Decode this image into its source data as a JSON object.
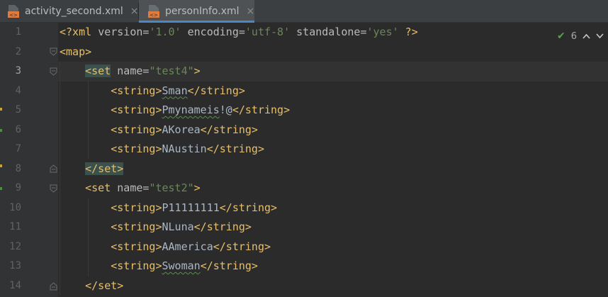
{
  "tabs": [
    {
      "label": "activity_second.xml",
      "active": false,
      "icon": "xml-file-icon",
      "close": "×"
    },
    {
      "label": "personInfo.xml",
      "active": true,
      "icon": "xml-file-icon",
      "close": "×"
    }
  ],
  "inspection": {
    "icon": "check-icon",
    "count": "6",
    "up": "^",
    "down": "v"
  },
  "lines": [
    {
      "number": "1",
      "segments": [
        {
          "t": "<?xml ",
          "c": "tg"
        },
        {
          "t": "version=",
          "c": "an"
        },
        {
          "t": "'1.0'",
          "c": "av"
        },
        {
          "t": " encoding=",
          "c": "an"
        },
        {
          "t": "'utf-8'",
          "c": "av"
        },
        {
          "t": " standalone=",
          "c": "an"
        },
        {
          "t": "'yes'",
          "c": "av"
        },
        {
          "t": " ?>",
          "c": "tg"
        }
      ]
    },
    {
      "number": "2",
      "segments": [
        {
          "t": "<map>",
          "c": "tg"
        }
      ]
    },
    {
      "number": "3",
      "segments": [
        {
          "t": "    ",
          "c": "tx"
        },
        {
          "t": "<set",
          "c": "tg",
          "hl": true
        },
        {
          "t": " name=",
          "c": "an"
        },
        {
          "t": "\"test4\"",
          "c": "av"
        },
        {
          "t": ">",
          "c": "tg"
        }
      ]
    },
    {
      "number": "4",
      "segments": [
        {
          "t": "        ",
          "c": "tx"
        },
        {
          "t": "<string>",
          "c": "tg"
        },
        {
          "t": "Sman",
          "c": "tx",
          "wavy": true
        },
        {
          "t": "</string>",
          "c": "tg"
        }
      ]
    },
    {
      "number": "5",
      "segments": [
        {
          "t": "        ",
          "c": "tx"
        },
        {
          "t": "<string>",
          "c": "tg"
        },
        {
          "t": "Pmynameis",
          "c": "tx",
          "wavy": true
        },
        {
          "t": "!@",
          "c": "tx"
        },
        {
          "t": "</string>",
          "c": "tg"
        }
      ]
    },
    {
      "number": "6",
      "segments": [
        {
          "t": "        ",
          "c": "tx"
        },
        {
          "t": "<string>",
          "c": "tg"
        },
        {
          "t": "AKorea",
          "c": "tx"
        },
        {
          "t": "</string>",
          "c": "tg"
        }
      ]
    },
    {
      "number": "7",
      "segments": [
        {
          "t": "        ",
          "c": "tx"
        },
        {
          "t": "<string>",
          "c": "tg"
        },
        {
          "t": "NAustin",
          "c": "tx"
        },
        {
          "t": "</string>",
          "c": "tg"
        }
      ]
    },
    {
      "number": "8",
      "segments": [
        {
          "t": "    ",
          "c": "tx"
        },
        {
          "t": "</set>",
          "c": "tg",
          "hl": true
        }
      ]
    },
    {
      "number": "9",
      "segments": [
        {
          "t": "    ",
          "c": "tx"
        },
        {
          "t": "<set",
          "c": "tg"
        },
        {
          "t": " name=",
          "c": "an"
        },
        {
          "t": "\"test2\"",
          "c": "av"
        },
        {
          "t": ">",
          "c": "tg"
        }
      ]
    },
    {
      "number": "10",
      "segments": [
        {
          "t": "        ",
          "c": "tx"
        },
        {
          "t": "<string>",
          "c": "tg"
        },
        {
          "t": "P11111111",
          "c": "tx"
        },
        {
          "t": "</string>",
          "c": "tg"
        }
      ]
    },
    {
      "number": "11",
      "segments": [
        {
          "t": "        ",
          "c": "tx"
        },
        {
          "t": "<string>",
          "c": "tg"
        },
        {
          "t": "NLuna",
          "c": "tx"
        },
        {
          "t": "</string>",
          "c": "tg"
        }
      ]
    },
    {
      "number": "12",
      "segments": [
        {
          "t": "        ",
          "c": "tx"
        },
        {
          "t": "<string>",
          "c": "tg"
        },
        {
          "t": "AAmerica",
          "c": "tx"
        },
        {
          "t": "</string>",
          "c": "tg"
        }
      ]
    },
    {
      "number": "13",
      "segments": [
        {
          "t": "        ",
          "c": "tx"
        },
        {
          "t": "<string>",
          "c": "tg"
        },
        {
          "t": "Swoman",
          "c": "tx",
          "wavy": true
        },
        {
          "t": "</string>",
          "c": "tg"
        }
      ]
    },
    {
      "number": "14",
      "segments": [
        {
          "t": "    ",
          "c": "tx"
        },
        {
          "t": "</set>",
          "c": "tg"
        }
      ]
    }
  ],
  "current_line": "3",
  "colors": {
    "background": "#2b2b2b",
    "gutter": "#313335",
    "tag": "#e8bf6a",
    "attribute_value": "#6a8759",
    "text": "#a9b7c6",
    "match_highlight": "#3b514d",
    "tab_underline": "#4a88c7"
  }
}
